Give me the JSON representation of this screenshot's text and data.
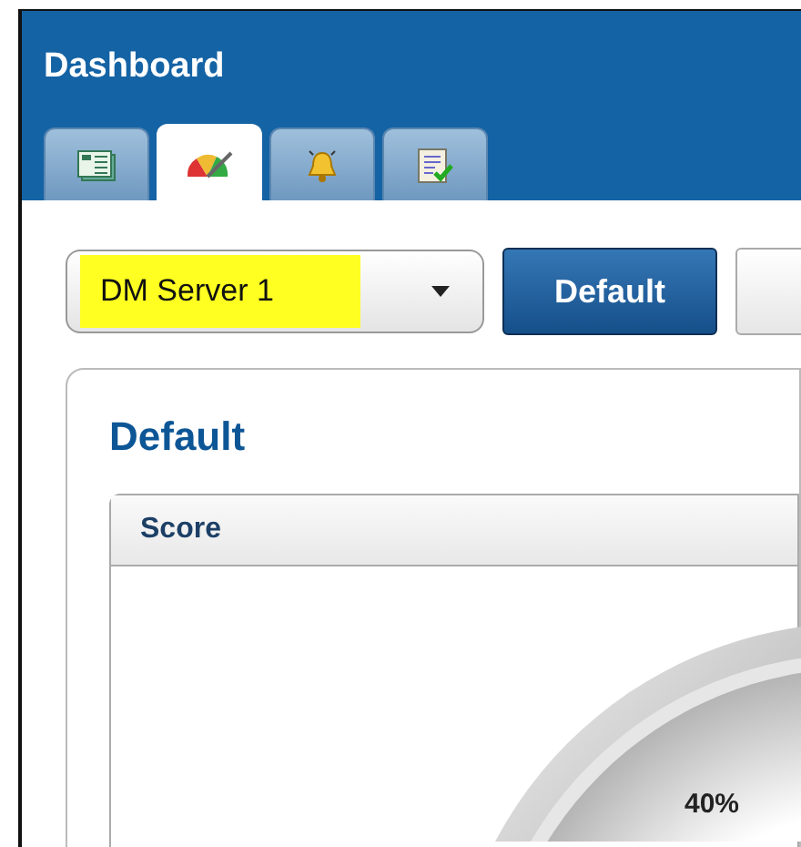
{
  "window": {
    "title": "Dashboard"
  },
  "tabs": [
    {
      "kind": "report",
      "selected": false
    },
    {
      "kind": "gauge",
      "selected": true
    },
    {
      "kind": "alarm",
      "selected": false
    },
    {
      "kind": "checklist",
      "selected": false
    }
  ],
  "toolbar": {
    "server_select": {
      "value": "DM Server 1",
      "highlighted": true
    },
    "buttons": [
      {
        "label": "Default",
        "selected": true
      },
      {
        "selected": false
      }
    ]
  },
  "panel": {
    "title": "Default",
    "widget": {
      "title": "Score",
      "gauge": {
        "reading": "40%"
      }
    }
  }
}
